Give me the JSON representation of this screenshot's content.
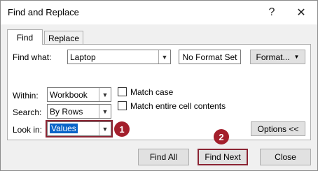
{
  "window": {
    "title": "Find and Replace",
    "help_icon": "?",
    "close_icon": "✕"
  },
  "tabs": [
    {
      "label": "Find"
    },
    {
      "label": "Replace"
    }
  ],
  "find_what": {
    "label": "Find what:",
    "value": "Laptop"
  },
  "format_set": {
    "label": "No Format Set"
  },
  "format_button": {
    "label": "Format..."
  },
  "within": {
    "label": "Within:",
    "value": "Workbook"
  },
  "search": {
    "label": "Search:",
    "value": "By Rows"
  },
  "look_in": {
    "label": "Look in:",
    "value": "Values"
  },
  "match_case": {
    "label": "Match case",
    "checked": false
  },
  "match_entire": {
    "label": "Match entire cell contents",
    "checked": false
  },
  "options_button": {
    "label": "Options <<"
  },
  "buttons": {
    "find_all": "Find All",
    "find_next": "Find Next",
    "close": "Close"
  },
  "annotations": {
    "badge1": "1",
    "badge2": "2",
    "color": "#a31f2c"
  }
}
